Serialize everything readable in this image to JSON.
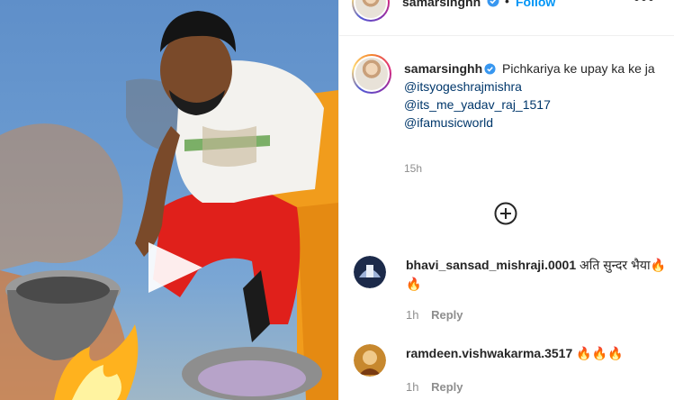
{
  "post": {
    "header": {
      "username": "samarsinghh",
      "separator": "•",
      "follow_label": "Follow",
      "more_label": "•••"
    },
    "caption": {
      "username": "samarsinghh",
      "text": "Pichkariya ke upay ka ke ja",
      "mentions": [
        "@itsyogeshrajmishra",
        "@its_me_yadav_raj_1517",
        "@ifamusicworld"
      ],
      "time": "15h"
    },
    "comments": [
      {
        "username": "bhavi_sansad_mishraji.0001",
        "text": "अति सुन्दर भैया🔥🔥",
        "time": "1h",
        "reply_label": "Reply"
      },
      {
        "username": "ramdeen.vishwakarma.3517",
        "text": "🔥🔥🔥",
        "time": "1h",
        "reply_label": "Reply"
      }
    ]
  },
  "colors": {
    "follow_blue": "#0095f6",
    "mention_blue": "#00376b",
    "meta_grey": "#8e8e8e",
    "verified_blue": "#3897f0"
  },
  "icons": {
    "verified": "verified-badge-icon",
    "play": "play-icon",
    "add_comment": "plus-circle-icon",
    "more": "more-options-icon"
  }
}
